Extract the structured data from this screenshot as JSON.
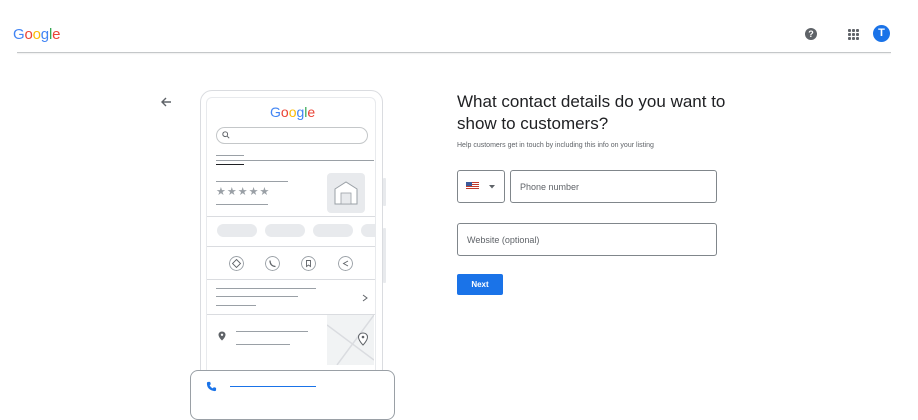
{
  "header": {
    "logo_letters": [
      "G",
      "o",
      "o",
      "g",
      "l",
      "e"
    ],
    "help_icon": "?",
    "apps_icon": "grid-apps-icon",
    "avatar_initial": "T"
  },
  "colors": {
    "google_blue": "#4285F4",
    "google_red": "#EA4335",
    "google_yellow": "#FBBC05",
    "google_green": "#34A853",
    "primary_button": "#1a73e8"
  },
  "illustration": {
    "logo_letters": [
      "G",
      "o",
      "o",
      "g",
      "l",
      "e"
    ],
    "stars": "★★★★★",
    "icons": [
      "directions-icon",
      "call-icon",
      "bookmark-icon",
      "share-icon",
      "chevron-right-icon",
      "location-pin-icon",
      "phone-call-icon"
    ]
  },
  "form": {
    "heading": "What contact details do you want to show to customers?",
    "subtext": "Help customers get in touch by including this info on your listing",
    "country": "US",
    "phone_placeholder": "Phone number",
    "website_placeholder": "Website (optional)",
    "next_label": "Next"
  }
}
